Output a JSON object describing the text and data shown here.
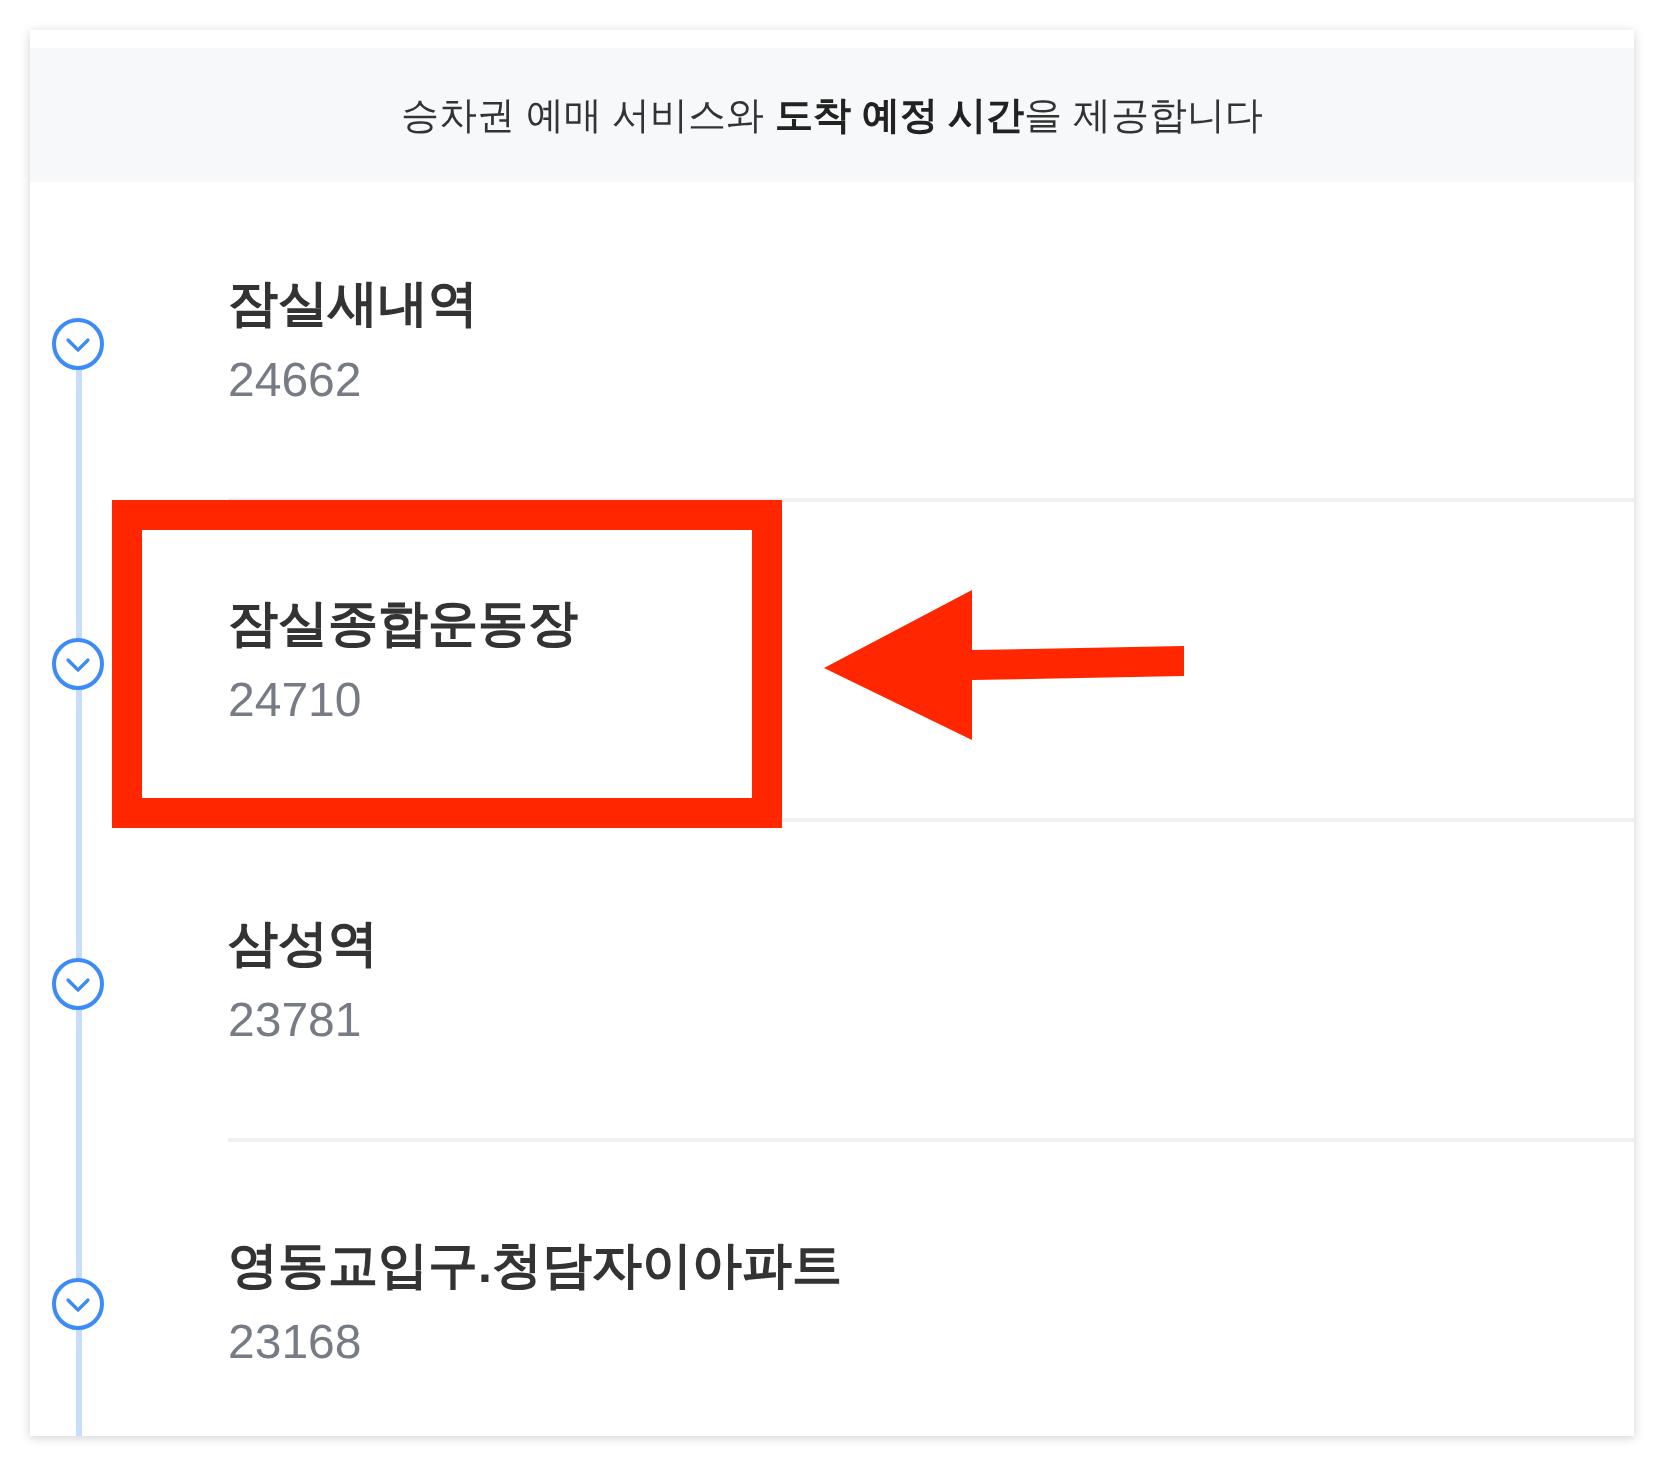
{
  "banner": {
    "text": "승차권 예매 서비스와 **도착 예정 시간**을 제공합니다"
  },
  "stops": [
    {
      "name": "잠실새내역",
      "number": "24662",
      "highlighted": false
    },
    {
      "name": "잠실종합운동장",
      "number": "24710",
      "highlighted": true
    },
    {
      "name": "삼성역",
      "number": "23781",
      "highlighted": false
    },
    {
      "name": "영동교입구.청담자이아파트",
      "number": "23168",
      "highlighted": false
    }
  ]
}
